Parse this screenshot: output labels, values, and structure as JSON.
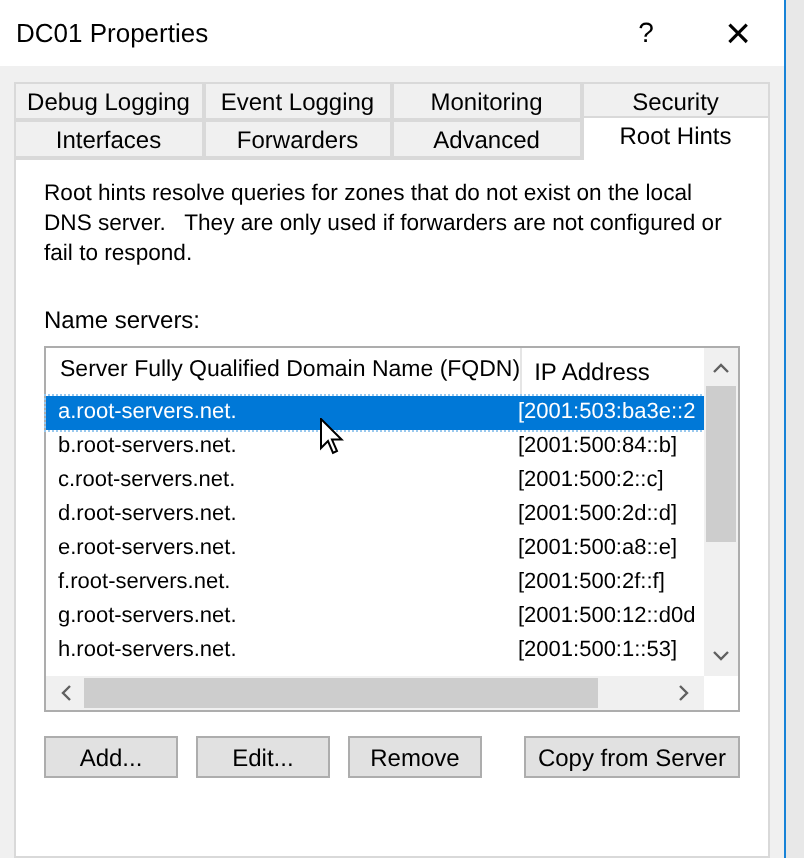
{
  "window": {
    "title": "DC01 Properties",
    "help": "?",
    "close": "×"
  },
  "tab_rows": [
    [
      {
        "label": "Debug Logging",
        "selected": false
      },
      {
        "label": "Event Logging",
        "selected": false
      },
      {
        "label": "Monitoring",
        "selected": false
      },
      {
        "label": "Security",
        "selected": false
      }
    ],
    [
      {
        "label": "Interfaces",
        "selected": false
      },
      {
        "label": "Forwarders",
        "selected": false
      },
      {
        "label": "Advanced",
        "selected": false
      },
      {
        "label": "Root Hints",
        "selected": true
      }
    ]
  ],
  "description": "Root hints resolve queries for zones that do not exist on the local DNS server.   They are only used if forwarders are not configured or fail to respond.",
  "list_label": "Name servers:",
  "table": {
    "columns": [
      "Server Fully Qualified Domain Name (FQDN)",
      "IP Address"
    ],
    "rows": [
      {
        "fqdn": "a.root-servers.net.",
        "ip": "[2001:503:ba3e::2",
        "selected": true
      },
      {
        "fqdn": "b.root-servers.net.",
        "ip": "[2001:500:84::b]",
        "selected": false
      },
      {
        "fqdn": "c.root-servers.net.",
        "ip": "[2001:500:2::c]",
        "selected": false
      },
      {
        "fqdn": "d.root-servers.net.",
        "ip": "[2001:500:2d::d]",
        "selected": false
      },
      {
        "fqdn": "e.root-servers.net.",
        "ip": "[2001:500:a8::e]",
        "selected": false
      },
      {
        "fqdn": "f.root-servers.net.",
        "ip": "[2001:500:2f::f]",
        "selected": false
      },
      {
        "fqdn": "g.root-servers.net.",
        "ip": "[2001:500:12::d0d",
        "selected": false
      },
      {
        "fqdn": "h.root-servers.net.",
        "ip": "[2001:500:1::53]",
        "selected": false
      }
    ]
  },
  "buttons": [
    "Add...",
    "Edit...",
    "Remove",
    "Copy from Server"
  ]
}
